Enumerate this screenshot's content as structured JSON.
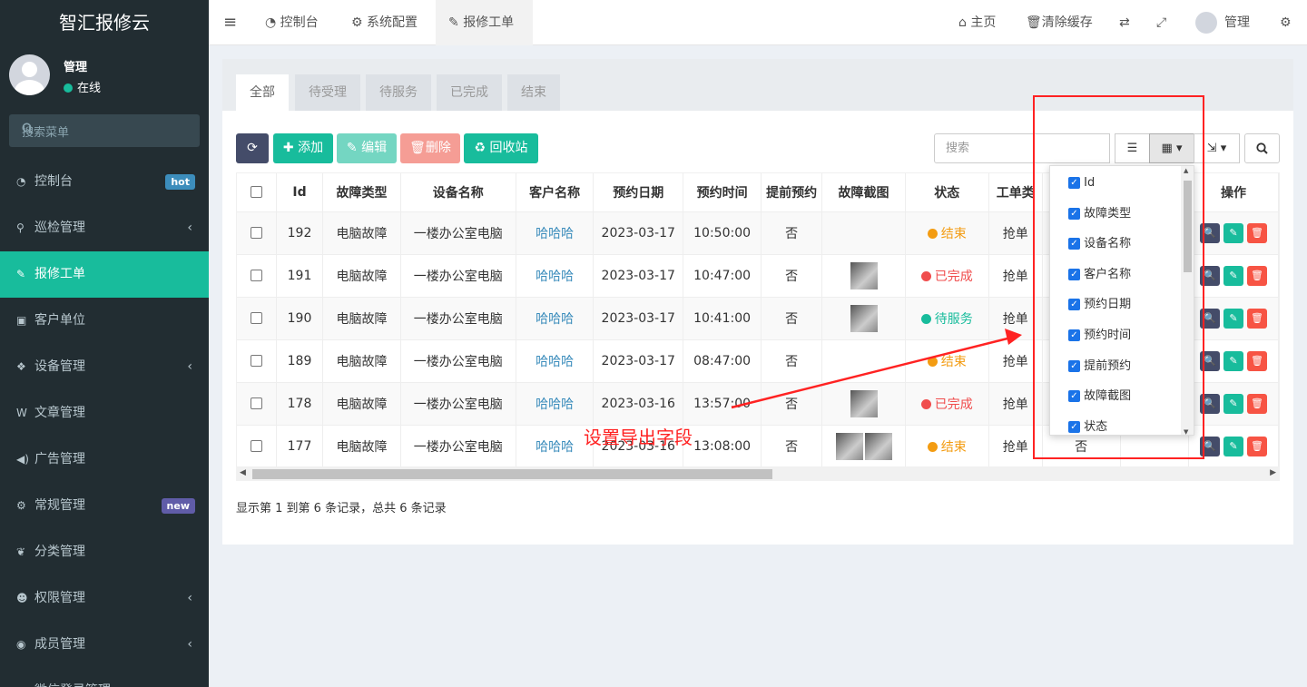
{
  "app": {
    "title": "智汇报修云"
  },
  "user": {
    "name": "管理",
    "status": "在线"
  },
  "sidebar_search": {
    "placeholder": "搜索菜单"
  },
  "menu": [
    {
      "label": "控制台",
      "icon": "dashboard-icon",
      "badge": "hot"
    },
    {
      "label": "巡检管理",
      "icon": "walk-icon",
      "arrow": "‹"
    },
    {
      "label": "报修工单",
      "icon": "wrench-icon",
      "active": true
    },
    {
      "label": "客户单位",
      "icon": "address-book-icon"
    },
    {
      "label": "设备管理",
      "icon": "cubes-icon",
      "arrow": "‹"
    },
    {
      "label": "文章管理",
      "icon": "wordpress-icon"
    },
    {
      "label": "广告管理",
      "icon": "volume-icon"
    },
    {
      "label": "常规管理",
      "icon": "cogs-icon",
      "badge": "new"
    },
    {
      "label": "分类管理",
      "icon": "leaf-icon"
    },
    {
      "label": "权限管理",
      "icon": "group-icon",
      "arrow": "‹"
    },
    {
      "label": "成员管理",
      "icon": "user-circle-icon",
      "arrow": "‹"
    },
    {
      "label": "微信登录管理",
      "icon": "wechat-icon"
    }
  ],
  "header": {
    "tabs": [
      "控制台",
      "系统配置",
      "报修工单"
    ],
    "home": "主页",
    "clear_cache": "清除缓存",
    "user": "管理"
  },
  "status_tabs": [
    "全部",
    "待受理",
    "待服务",
    "已完成",
    "结束"
  ],
  "toolbar": {
    "add": "添加",
    "edit": "编辑",
    "delete": "删除",
    "recycle": "回收站",
    "search_placeholder": "搜索"
  },
  "columns": [
    "Id",
    "故障类型",
    "设备名称",
    "客户名称",
    "预约日期",
    "预约时间",
    "提前预约",
    "故障截图",
    "状态",
    "工单类",
    "",
    "",
    "操作"
  ],
  "rows": [
    {
      "id": "192",
      "type": "电脑故障",
      "device": "一楼办公室电脑",
      "customer": "哈哈哈",
      "date": "2023-03-17",
      "time": "10:50:00",
      "early": "否",
      "images": 0,
      "status": "结束",
      "status_color": "#f39c12",
      "order": "抢单"
    },
    {
      "id": "191",
      "type": "电脑故障",
      "device": "一楼办公室电脑",
      "customer": "哈哈哈",
      "date": "2023-03-17",
      "time": "10:47:00",
      "early": "否",
      "images": 1,
      "status": "已完成",
      "status_color": "#f04d4d",
      "order": "抢单"
    },
    {
      "id": "190",
      "type": "电脑故障",
      "device": "一楼办公室电脑",
      "customer": "哈哈哈",
      "date": "2023-03-17",
      "time": "10:41:00",
      "early": "否",
      "images": 1,
      "status": "待服务",
      "status_color": "#18bc9c",
      "order": "抢单"
    },
    {
      "id": "189",
      "type": "电脑故障",
      "device": "一楼办公室电脑",
      "customer": "哈哈哈",
      "date": "2023-03-17",
      "time": "08:47:00",
      "early": "否",
      "images": 0,
      "status": "结束",
      "status_color": "#f39c12",
      "order": "抢单"
    },
    {
      "id": "178",
      "type": "电脑故障",
      "device": "一楼办公室电脑",
      "customer": "哈哈哈",
      "date": "2023-03-16",
      "time": "13:57:00",
      "early": "否",
      "images": 1,
      "status": "已完成",
      "status_color": "#f04d4d",
      "order": "抢单"
    },
    {
      "id": "177",
      "type": "电脑故障",
      "device": "一楼办公室电脑",
      "customer": "哈哈哈",
      "date": "2023-03-16",
      "time": "13:08:00",
      "early": "否",
      "images": 2,
      "status": "结束",
      "status_color": "#f39c12",
      "order": "抢单",
      "extra": "否"
    }
  ],
  "column_dropdown": [
    "Id",
    "故障类型",
    "设备名称",
    "客户名称",
    "预约日期",
    "预约时间",
    "提前预约",
    "故障截图",
    "状态"
  ],
  "footer": "显示第 1 到第 6 条记录，总共 6 条记录",
  "annotation": "设置导出字段"
}
